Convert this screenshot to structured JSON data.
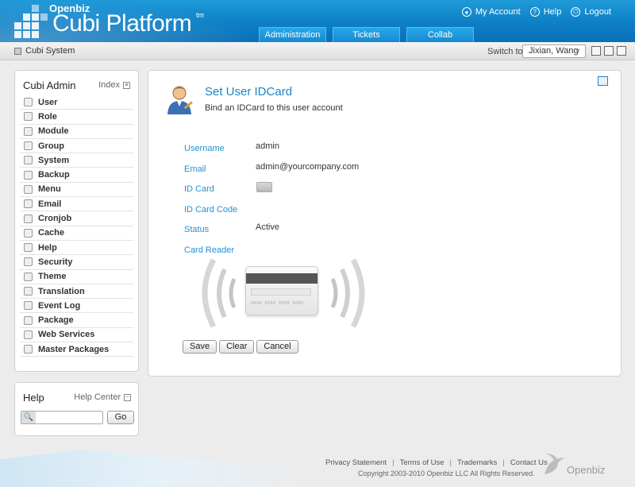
{
  "header": {
    "logo_small": "Openbiz",
    "logo_big": "Cubi Platform",
    "logo_tm": "tm",
    "links": [
      {
        "label": "My Account"
      },
      {
        "label": "Help"
      },
      {
        "label": "Logout"
      }
    ],
    "tabs": [
      {
        "label": "Administration"
      },
      {
        "label": "Tickets"
      },
      {
        "label": "Collab"
      }
    ]
  },
  "subbar": {
    "breadcrumb": "Cubi System",
    "switch_label": "Switch to",
    "switch_value": "Jixian, Wang"
  },
  "sidebar": {
    "title": "Cubi Admin",
    "index_label": "Index",
    "items": [
      {
        "label": "User"
      },
      {
        "label": "Role"
      },
      {
        "label": "Module"
      },
      {
        "label": "Group"
      },
      {
        "label": "System"
      },
      {
        "label": "Backup"
      },
      {
        "label": "Menu"
      },
      {
        "label": "Email"
      },
      {
        "label": "Cronjob"
      },
      {
        "label": "Cache"
      },
      {
        "label": "Help"
      },
      {
        "label": "Security"
      },
      {
        "label": "Theme"
      },
      {
        "label": "Translation"
      },
      {
        "label": "Event Log"
      },
      {
        "label": "Package"
      },
      {
        "label": "Web Services"
      },
      {
        "label": "Master Packages"
      }
    ]
  },
  "help_panel": {
    "title": "Help",
    "center_label": "Help Center",
    "search_value": "",
    "go_label": "Go"
  },
  "main": {
    "title": "Set User IDCard",
    "subtitle": "Bind an IDCard to this user account",
    "fields": {
      "username_label": "Username",
      "username_value": "admin",
      "email_label": "Email",
      "email_value": "admin@yourcompany.com",
      "idcard_label": "ID Card",
      "idcard_code_label": "ID Card Code",
      "status_label": "Status",
      "status_value": "Active",
      "reader_label": "Card Reader"
    },
    "card_numbers": "0000 0000 0000 0000",
    "buttons": {
      "save": "Save",
      "clear": "Clear",
      "cancel": "Cancel"
    }
  },
  "footer": {
    "links": [
      {
        "label": "Privacy Statement"
      },
      {
        "label": "Terms of Use"
      },
      {
        "label": "Trademarks"
      },
      {
        "label": "Contact Us"
      }
    ],
    "separator": "|",
    "copyright": "Copyright 2003-2010 Openbiz LLC All Rights Reserved.",
    "brand": "Openbiz"
  },
  "colors": {
    "header_blue": "#0d7fc6",
    "label_blue": "#2590d4",
    "title_blue": "#1a85c8"
  }
}
